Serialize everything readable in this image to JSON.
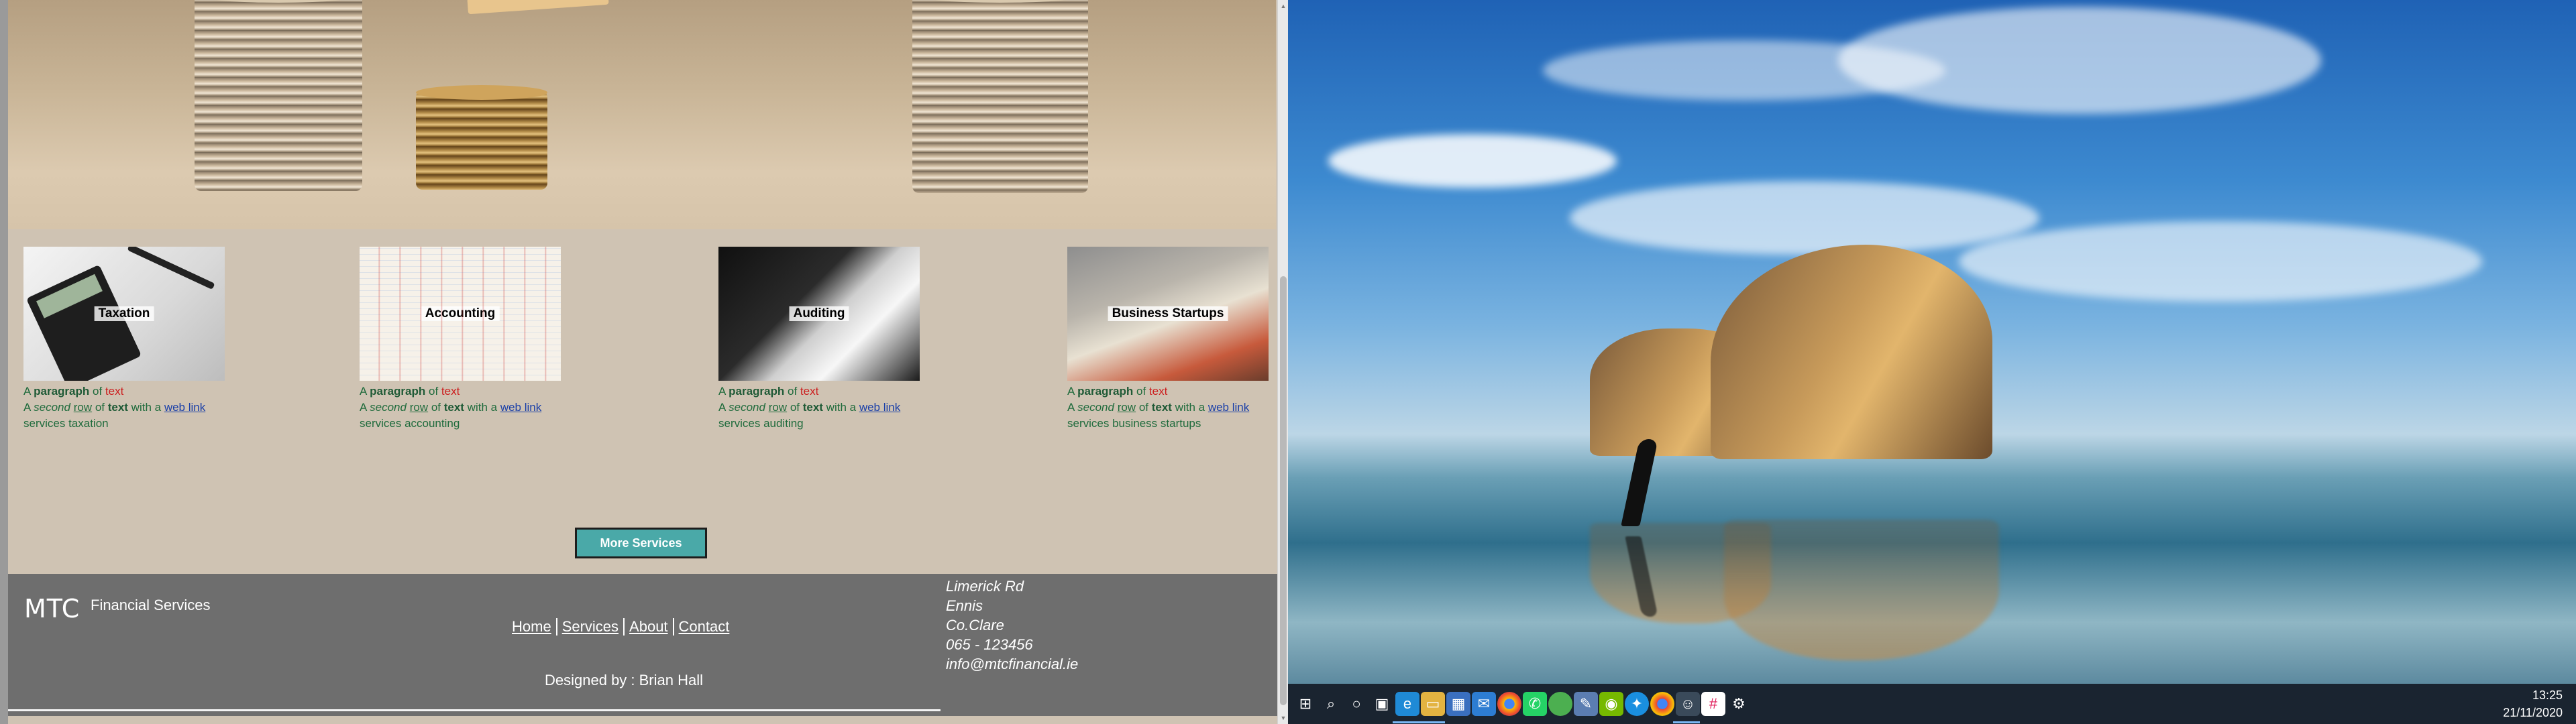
{
  "browser": {
    "services": [
      {
        "title": "Taxation",
        "line1_prefix": "A ",
        "line1_bold": "paragraph",
        "line1_mid": " of ",
        "line1_red": "text",
        "line2_a": "A ",
        "line2_italic": "second",
        "line2_space": " ",
        "line2_under": "row",
        "line2_mid": " of ",
        "line2_bold": "text",
        "line2_end": " with a ",
        "link": "web link",
        "tail": " services taxation"
      },
      {
        "title": "Accounting",
        "line1_prefix": "A ",
        "line1_bold": "paragraph",
        "line1_mid": " of ",
        "line1_red": "text",
        "line2_a": "A ",
        "line2_italic": "second",
        "line2_space": " ",
        "line2_under": "row",
        "line2_mid": " of ",
        "line2_bold": "text",
        "line2_end": " with a ",
        "link": "web link",
        "tail": " services accounting"
      },
      {
        "title": "Auditing",
        "line1_prefix": "A ",
        "line1_bold": "paragraph",
        "line1_mid": " of ",
        "line1_red": "text",
        "line2_a": "A ",
        "line2_italic": "second",
        "line2_space": " ",
        "line2_under": "row",
        "line2_mid": " of ",
        "line2_bold": "text",
        "line2_end": " with a ",
        "link": "web link",
        "tail": " services auditing"
      },
      {
        "title": "Business Startups",
        "line1_prefix": "A ",
        "line1_bold": "paragraph",
        "line1_mid": " of ",
        "line1_red": "text",
        "line2_a": "A ",
        "line2_italic": "second",
        "line2_space": " ",
        "line2_under": "row",
        "line2_mid": " of ",
        "line2_bold": "text",
        "line2_end": " with a ",
        "link": "web link",
        "tail": " services business startups"
      }
    ],
    "more_services_label": "More Services",
    "footer": {
      "logo": "MTC",
      "brand": "Financial Services",
      "nav": [
        "Home",
        "Services",
        "About",
        "Contact"
      ],
      "credit": "Designed by : Brian Hall",
      "address": [
        "Limerick Rd",
        "Ennis",
        "Co.Clare",
        "065 - 123456",
        "info@mtcfinancial.ie"
      ]
    },
    "colors": {
      "page_bg": "#cfc3b3",
      "footer_bg": "#6e6e6e",
      "button_bg": "#4aa9a8",
      "text_green": "#1f6b3c",
      "text_red": "#cc1f1f",
      "link_blue": "#1a3fa8"
    }
  },
  "desktop": {
    "taskbar_icons": [
      "windows-start-icon",
      "search-icon",
      "cortana-icon",
      "task-view-icon",
      "edge-icon",
      "file-explorer-icon",
      "store-icon",
      "mail-icon",
      "chrome-icon",
      "whatsapp-icon",
      "green-app-icon",
      "notepad-icon",
      "nvidia-icon",
      "safari-icon",
      "chrome-alt-icon",
      "smiley-icon",
      "slack-icon",
      "satellite-app-icon"
    ],
    "clock": {
      "time": "13:25",
      "date": "21/11/2020"
    }
  }
}
